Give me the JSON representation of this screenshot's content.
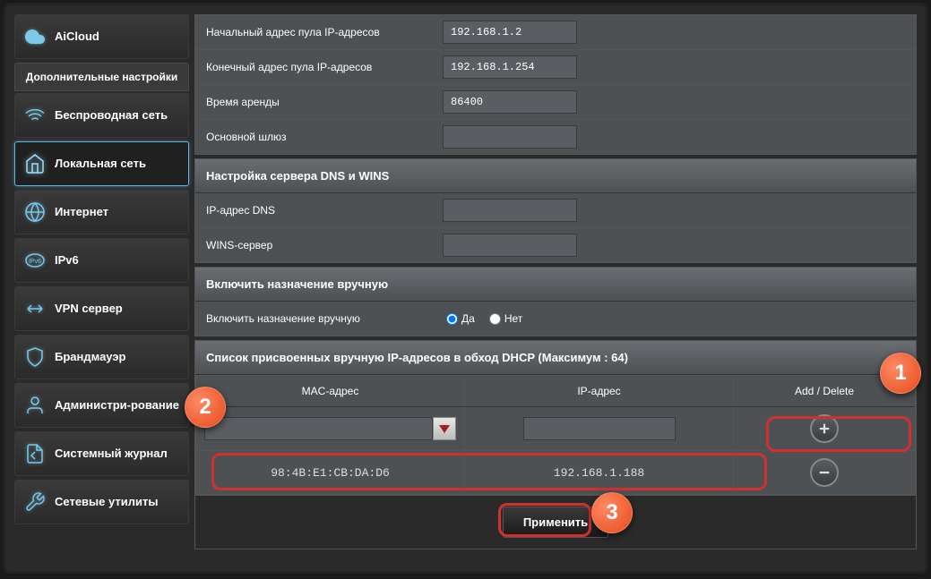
{
  "sidebar": {
    "aicloud": "AiCloud",
    "sectionTitle": "Дополнительные настройки",
    "items": [
      {
        "label": "Беспроводная сеть"
      },
      {
        "label": "Локальная сеть"
      },
      {
        "label": "Интернет"
      },
      {
        "label": "IPv6"
      },
      {
        "label": "VPN сервер"
      },
      {
        "label": "Брандмауэр"
      },
      {
        "label": "Администри-рование"
      },
      {
        "label": "Системный журнал"
      },
      {
        "label": "Сетевые утилиты"
      }
    ]
  },
  "pool": {
    "startLabel": "Начальный адрес пула IP-адресов",
    "startValue": "192.168.1.2",
    "endLabel": "Конечный адрес пула IP-адресов",
    "endValue": "192.168.1.254",
    "leaseLabel": "Время аренды",
    "leaseValue": "86400",
    "gatewayLabel": "Основной шлюз",
    "gatewayValue": ""
  },
  "dns": {
    "header": "Настройка сервера DNS и WINS",
    "dnsLabel": "IP-адрес DNS",
    "dnsValue": "",
    "winsLabel": "WINS-сервер",
    "winsValue": ""
  },
  "manual": {
    "header": "Включить назначение вручную",
    "label": "Включить назначение вручную",
    "yes": "Да",
    "no": "Нет"
  },
  "list": {
    "header": "Список присвоенных вручную IP-адресов в обход DHCP (Максимум : 64)",
    "colMac": "MAC-адрес",
    "colIp": "IP-адрес",
    "colAct": "Add / Delete",
    "newMac": "",
    "newIp": "",
    "rows": [
      {
        "mac": "98:4B:E1:CB:DA:D6",
        "ip": "192.168.1.188"
      }
    ]
  },
  "apply": "Применить",
  "callouts": {
    "c1": "1",
    "c2": "2",
    "c3": "3"
  }
}
